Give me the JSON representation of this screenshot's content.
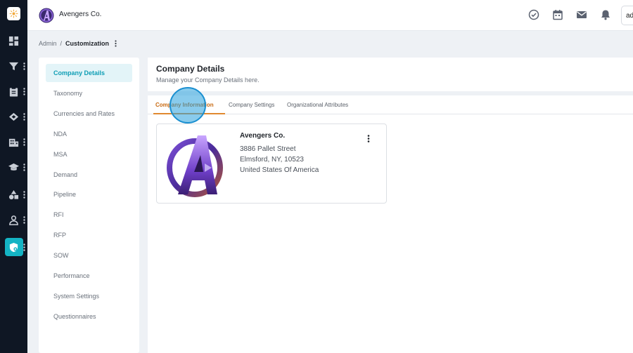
{
  "app": {
    "brand_name": "Avengers Co.",
    "user_initials": "ad"
  },
  "breadcrumb": {
    "parent": "Admin",
    "separator": "/",
    "current": "Customization"
  },
  "side_menu": {
    "items": [
      {
        "label": "Company Details",
        "active": true
      },
      {
        "label": "Taxonomy"
      },
      {
        "label": "Currencies and Rates"
      },
      {
        "label": "NDA"
      },
      {
        "label": "MSA"
      },
      {
        "label": "Demand"
      },
      {
        "label": "Pipeline"
      },
      {
        "label": "RFI"
      },
      {
        "label": "RFP"
      },
      {
        "label": "SOW"
      },
      {
        "label": "Performance"
      },
      {
        "label": "System Settings"
      },
      {
        "label": "Questionnaires"
      }
    ]
  },
  "main": {
    "title": "Company Details",
    "subtitle": "Manage your Company Details here.",
    "tabs": [
      {
        "label": "Company Information",
        "active": true
      },
      {
        "label": "Company Settings"
      },
      {
        "label": "Organizational Attributes"
      }
    ],
    "card": {
      "name": "Avengers Co.",
      "address_line1": "3886 Pallet Street",
      "address_line2": "Elmsford, NY, 10523",
      "address_line3": "United States Of America"
    }
  },
  "icons": {
    "rail": [
      "app-logo-icon",
      "dashboard-icon",
      "filter-icon",
      "clipboard-icon",
      "handshake-icon",
      "building-icon",
      "graduation-cap-icon",
      "shapes-icon",
      "user-icon",
      "shield-gear-icon"
    ],
    "topbar": [
      "check-circle-icon",
      "calendar-icon",
      "mail-icon",
      "bell-icon"
    ]
  },
  "colors": {
    "rail_bg": "#0f1724",
    "accent": "#14b4c4",
    "active_tab": "#e0892f",
    "side_active_bg": "#e3f4f8"
  }
}
